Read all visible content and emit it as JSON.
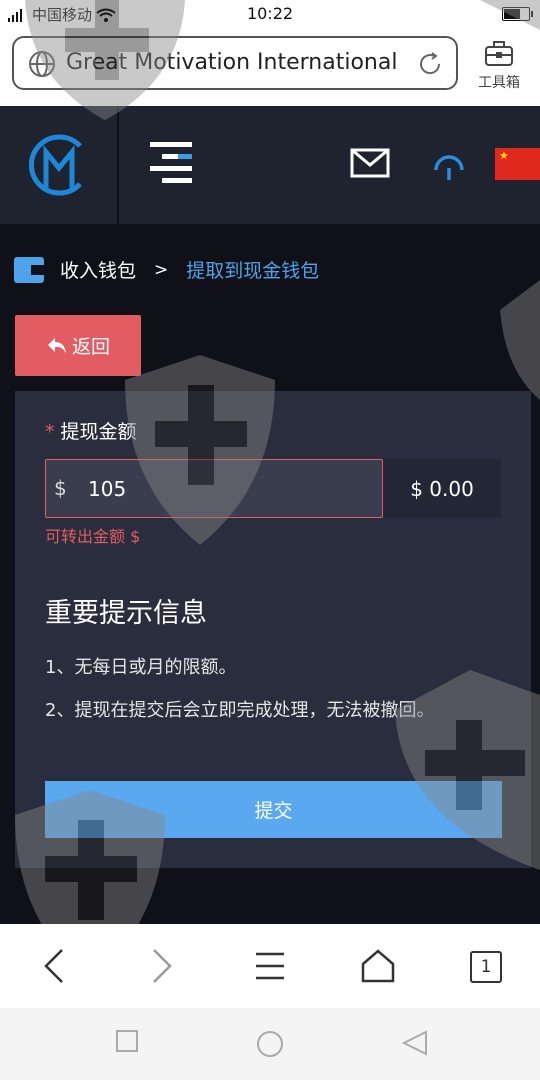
{
  "status_bar": {
    "carrier": "中国移动",
    "time": "10:22"
  },
  "browser": {
    "url_title": "Great Motivation International",
    "toolbox_label": "工具箱",
    "tab_count": "1"
  },
  "breadcrumb": {
    "item1": "收入钱包",
    "separator": ">",
    "item2": "提取到现金钱包"
  },
  "back_button": {
    "label": "返回"
  },
  "form": {
    "required_mark": "*",
    "label": "提现金额",
    "currency_symbol": "$",
    "amount_value": "105",
    "converted_value": "$ 0.00",
    "hint": "可转出金额 $"
  },
  "info": {
    "title": "重要提示信息",
    "line1": "1、无每日或月的限额。",
    "line2": "2、提现在提交后会立即完成处理，无法被撤回。"
  },
  "submit_button": {
    "label": "提交"
  },
  "colors": {
    "accent_blue": "#5aa8f0",
    "danger_red": "#e15d62",
    "header_bg": "#1f2330",
    "panel_bg": "#292d3d"
  }
}
